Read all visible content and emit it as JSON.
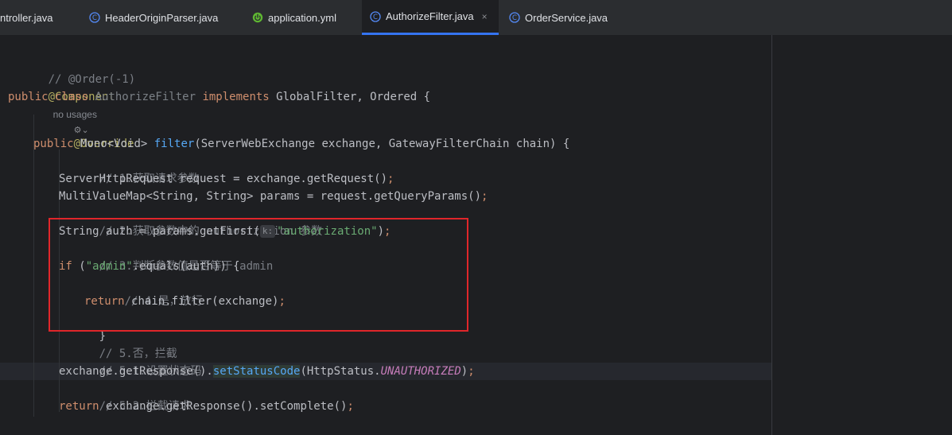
{
  "tabs": [
    {
      "label": "ntroller.java",
      "icon": "none",
      "active": false
    },
    {
      "label": "HeaderOriginParser.java",
      "icon": "java-class-icon",
      "active": false
    },
    {
      "label": "application.yml",
      "icon": "spring-config-icon",
      "active": false
    },
    {
      "label": "AuthorizeFilter.java",
      "icon": "java-class-icon",
      "active": true,
      "close": "×"
    },
    {
      "label": "OrderService.java",
      "icon": "java-class-icon",
      "active": false
    }
  ],
  "code": {
    "l1": "// @Order(-1)",
    "l2_annotation": "@Component",
    "l2_hint": "no usages",
    "l3_kw": "public class ",
    "l3_name": "AuthorizeFilter",
    "l3_impl": " implements ",
    "l3_rest": "GlobalFilter, Ordered {",
    "l4_icons": "⚙⌄",
    "l5": "@Override",
    "l6_kw": "public ",
    "l6_type": "Mono<Void> ",
    "l6_fn": "filter",
    "l6_rest": "(ServerWebExchange exchange, GatewayFilterChain chain) {",
    "l7": "// 1.获取请求参数",
    "l8_a": "ServerHttpRequest request = exchange.getRequest()",
    "l8_semi": ";",
    "l9_a": "MultiValueMap<String, String> params = request.getQueryParams()",
    "l9_semi": ";",
    "l10": "// 2.获取参数中的 authorization 参数",
    "l11_a": "String auth = params.getFirst(",
    "l11_hint": "k:",
    "l11_str": "\"authorization\"",
    "l11_b": ")",
    "l11_semi": ";",
    "l12": "// 3.判断参数值是否等于 admin",
    "l13_kw": "if ",
    "l13_a": "(",
    "l13_str": "\"admin\"",
    "l13_b": ".equals(auth)) {",
    "l14": "// 4.是，放行",
    "l15_kw": "return ",
    "l15_a": "chain.filter(exchange)",
    "l15_semi": ";",
    "l16": "}",
    "l17": "// 5.否，拦截",
    "l18": "// 5.1.设置状态码",
    "l19_a": "exchange.getResponse().",
    "l19_fn": "setStatusCode",
    "l19_b": "(HttpStatus.",
    "l19_const": "UNAUTHORIZED",
    "l19_c": ")",
    "l19_semi": ";",
    "l20": "// 5.2.拦截请求",
    "l21_kw": "return ",
    "l21_a": "exchange.getResponse().setComplete()",
    "l21_semi": ";",
    "l22": "}"
  },
  "colors": {
    "highlight_box": "#e0262a",
    "active_tab_underline": "#3574f0"
  }
}
